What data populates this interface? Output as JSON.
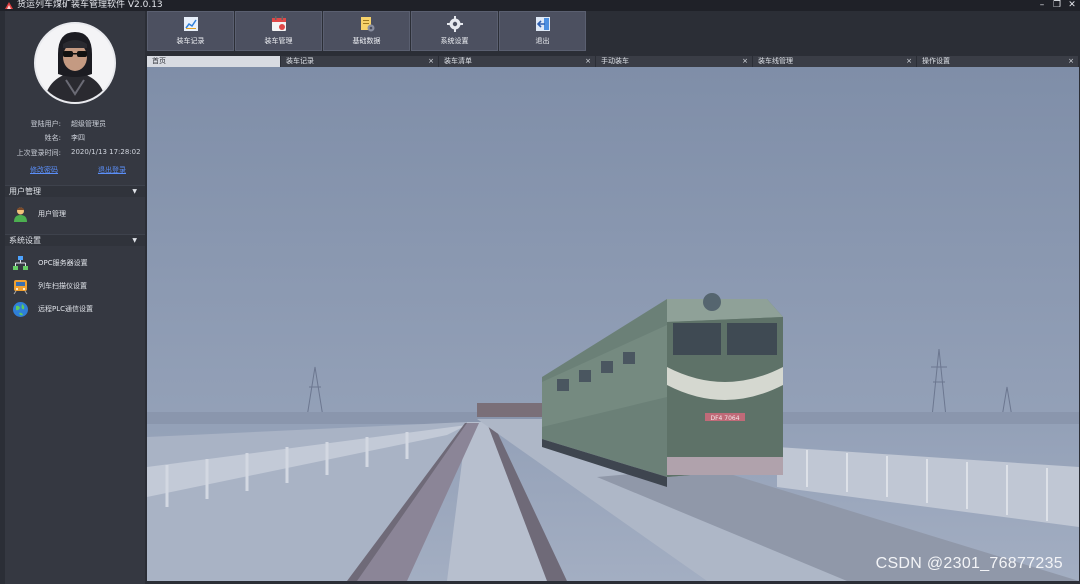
{
  "window": {
    "title": "货运列车煤矿装车管理软件 V2.0.13",
    "controls": [
      "–",
      "❐",
      "✕"
    ]
  },
  "user": {
    "login_label": "登陆用户:",
    "login_value": "超级管理员",
    "name_label": "姓名:",
    "name_value": "李四",
    "last_login_label": "上次登录时间:",
    "last_login_value": "2020/1/13 17:28:02",
    "link_change_password": "修改密码",
    "link_logout": "退出登录"
  },
  "sidebar": {
    "groups": [
      {
        "title": "用户管理",
        "caret": "▼",
        "items": [
          {
            "label": "用户管理",
            "icon": "user-icon"
          }
        ]
      },
      {
        "title": "系统设置",
        "caret": "▼",
        "items": [
          {
            "label": "OPC服务器设置",
            "icon": "network-icon"
          },
          {
            "label": "列车扫描仪设置",
            "icon": "train-icon"
          },
          {
            "label": "远程PLC通信设置",
            "icon": "globe-icon"
          }
        ]
      }
    ]
  },
  "toolbar": {
    "buttons": [
      {
        "label": "装车记录",
        "icon": "chart-icon"
      },
      {
        "label": "装车管理",
        "icon": "calendar-icon"
      },
      {
        "label": "基础数据",
        "icon": "document-gear-icon"
      },
      {
        "label": "系统设置",
        "icon": "gear-icon"
      },
      {
        "label": "退出",
        "icon": "exit-icon"
      }
    ]
  },
  "tabs": [
    {
      "label": "首页",
      "closable": false
    },
    {
      "label": "装车记录",
      "closable": true
    },
    {
      "label": "装车清单",
      "closable": true
    },
    {
      "label": "手动装车",
      "closable": true
    },
    {
      "label": "装车线管理",
      "closable": true
    },
    {
      "label": "操作设置",
      "closable": true
    }
  ],
  "tab_close_glyph": "×",
  "main": {
    "watermark": "CSDN @2301_76877235",
    "train_number": "DF4 7064"
  },
  "colors": {
    "background": "#2b2e36",
    "sidebar": "#353841",
    "toolbar_button": "#4c5060",
    "link": "#5b8ff9",
    "active_tab": "#d8dbe2"
  }
}
